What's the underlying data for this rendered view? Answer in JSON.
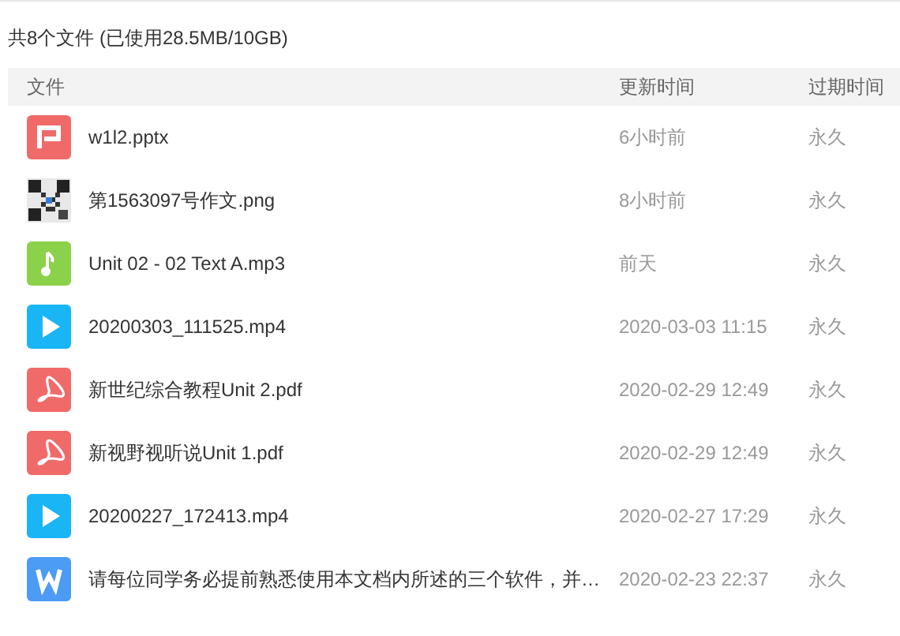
{
  "summary": "共8个文件 (已使用28.5MB/10GB)",
  "table": {
    "columns": [
      "文件",
      "更新时间",
      "过期时间"
    ],
    "rows": [
      {
        "kind": "ppt",
        "name": "w1l2.pptx",
        "updated": "6小时前",
        "expires": "永久"
      },
      {
        "kind": "picture",
        "name": "第1563097号作文.png",
        "updated": "8小时前",
        "expires": "永久"
      },
      {
        "kind": "audio",
        "name": "Unit 02 - 02 Text A.mp3",
        "updated": "前天",
        "expires": "永久"
      },
      {
        "kind": "video",
        "name": "20200303_111525.mp4",
        "updated": "2020-03-03 11:15",
        "expires": "永久"
      },
      {
        "kind": "pdf",
        "name": "新世纪综合教程Unit 2.pdf",
        "updated": "2020-02-29 12:49",
        "expires": "永久"
      },
      {
        "kind": "pdf",
        "name": "新视野视听说Unit 1.pdf",
        "updated": "2020-02-29 12:49",
        "expires": "永久"
      },
      {
        "kind": "video",
        "name": "20200227_172413.mp4",
        "updated": "2020-02-27 17:29",
        "expires": "永久"
      },
      {
        "kind": "word",
        "name": "请每位同学务必提前熟悉使用本文档内所述的三个软件，并…",
        "updated": "2020-02-23 22:37",
        "expires": "永久"
      }
    ]
  }
}
